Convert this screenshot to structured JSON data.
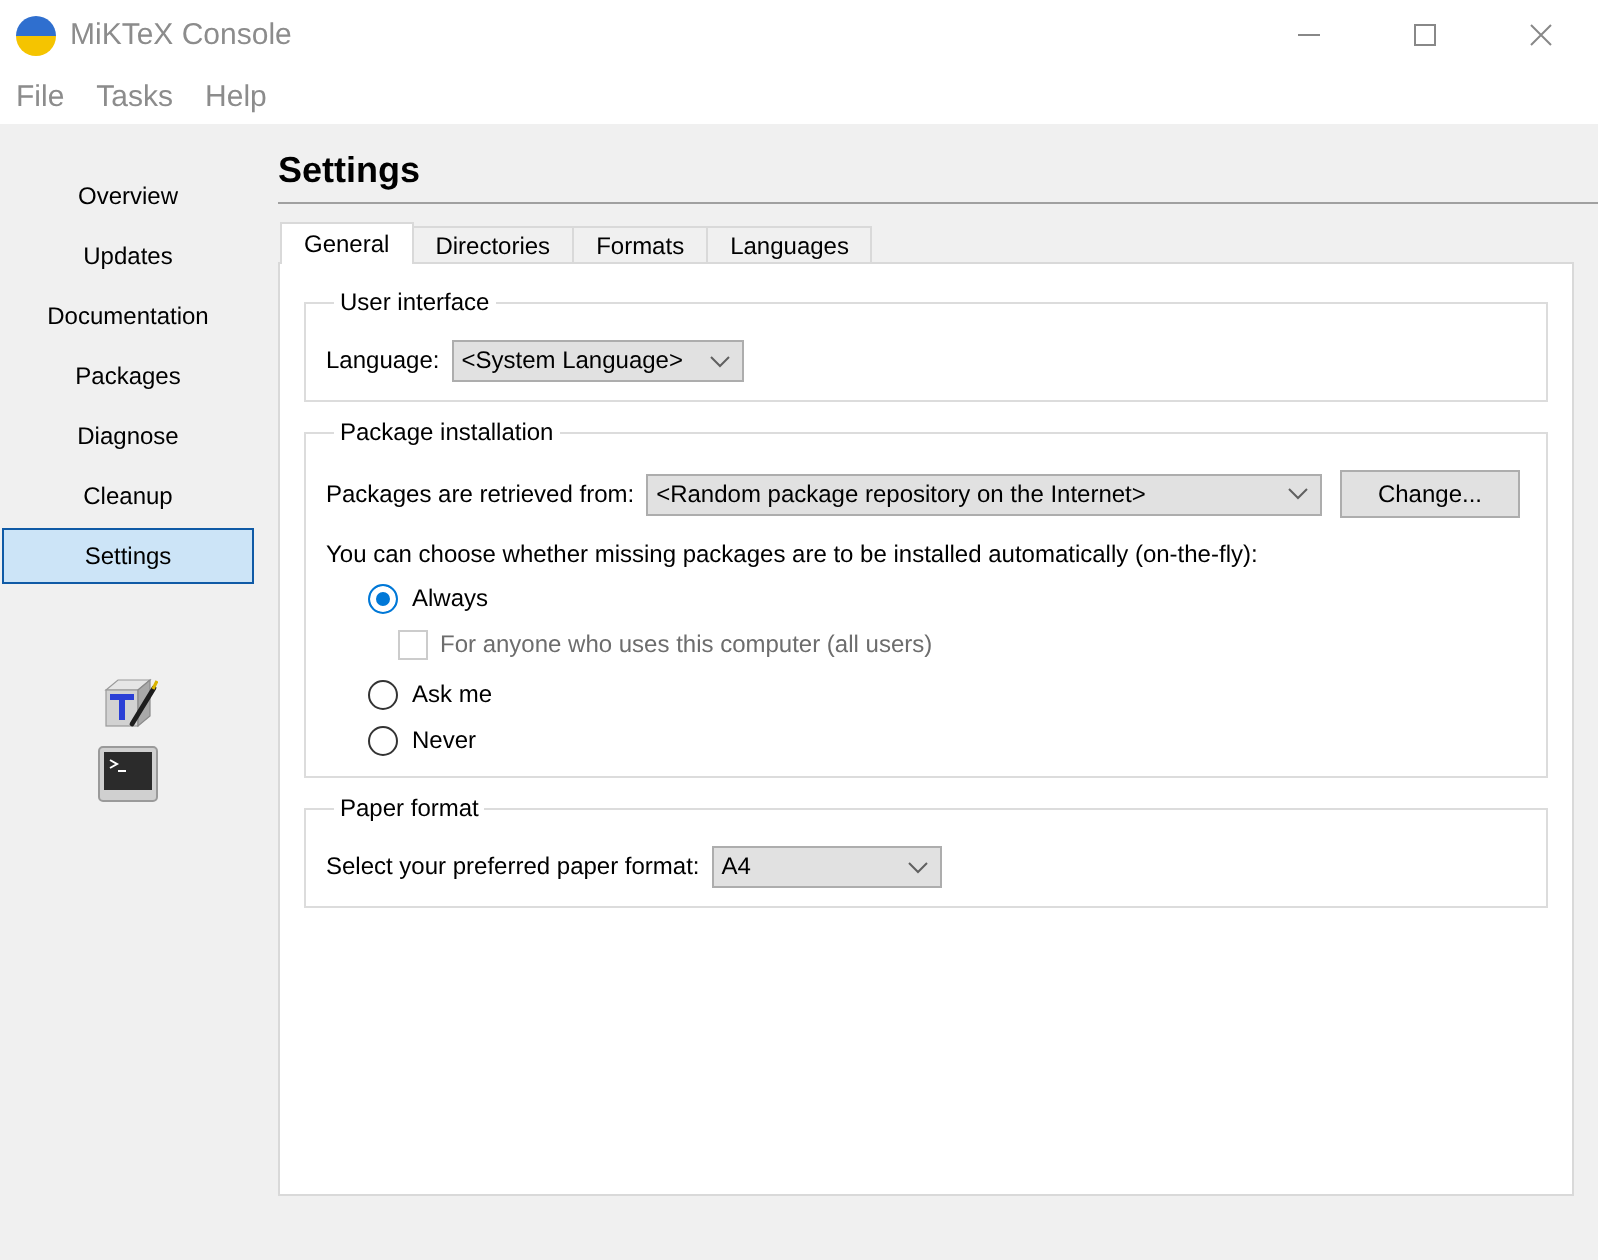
{
  "window": {
    "title": "MiKTeX Console"
  },
  "menu": [
    {
      "label": "File"
    },
    {
      "label": "Tasks"
    },
    {
      "label": "Help"
    }
  ],
  "sidebar": {
    "items": [
      {
        "label": "Overview",
        "selected": false
      },
      {
        "label": "Updates",
        "selected": false
      },
      {
        "label": "Documentation",
        "selected": false
      },
      {
        "label": "Packages",
        "selected": false
      },
      {
        "label": "Diagnose",
        "selected": false
      },
      {
        "label": "Cleanup",
        "selected": false
      },
      {
        "label": "Settings",
        "selected": true
      }
    ]
  },
  "page": {
    "title": "Settings",
    "tabs": [
      {
        "label": "General",
        "selected": true
      },
      {
        "label": "Directories",
        "selected": false
      },
      {
        "label": "Formats",
        "selected": false
      },
      {
        "label": "Languages",
        "selected": false
      }
    ],
    "groups": [
      {
        "title": "User interface",
        "items": [
          {
            "kind": "combo",
            "label": "Language:",
            "value": "<System Language>"
          }
        ]
      },
      {
        "title": "Package installation",
        "items": [
          {
            "kind": "combo",
            "label": "Packages are retrieved from:",
            "value": "<Random package repository on the Internet>",
            "button": "Change..."
          },
          {
            "kind": "text",
            "text": "You can choose whether missing packages are to be installed automatically (on-the-fly):"
          },
          {
            "kind": "radio",
            "label": "Always",
            "selected": true,
            "children": [
              {
                "kind": "checkbox",
                "label": "For anyone who uses this computer (all users)",
                "checked": false,
                "disabled": true
              }
            ]
          },
          {
            "kind": "radio",
            "label": "Ask me",
            "selected": false
          },
          {
            "kind": "radio",
            "label": "Never",
            "selected": false
          }
        ]
      },
      {
        "title": "Paper format",
        "items": [
          {
            "kind": "combo",
            "label": "Select your preferred paper format:",
            "value": "A4"
          }
        ]
      }
    ]
  }
}
